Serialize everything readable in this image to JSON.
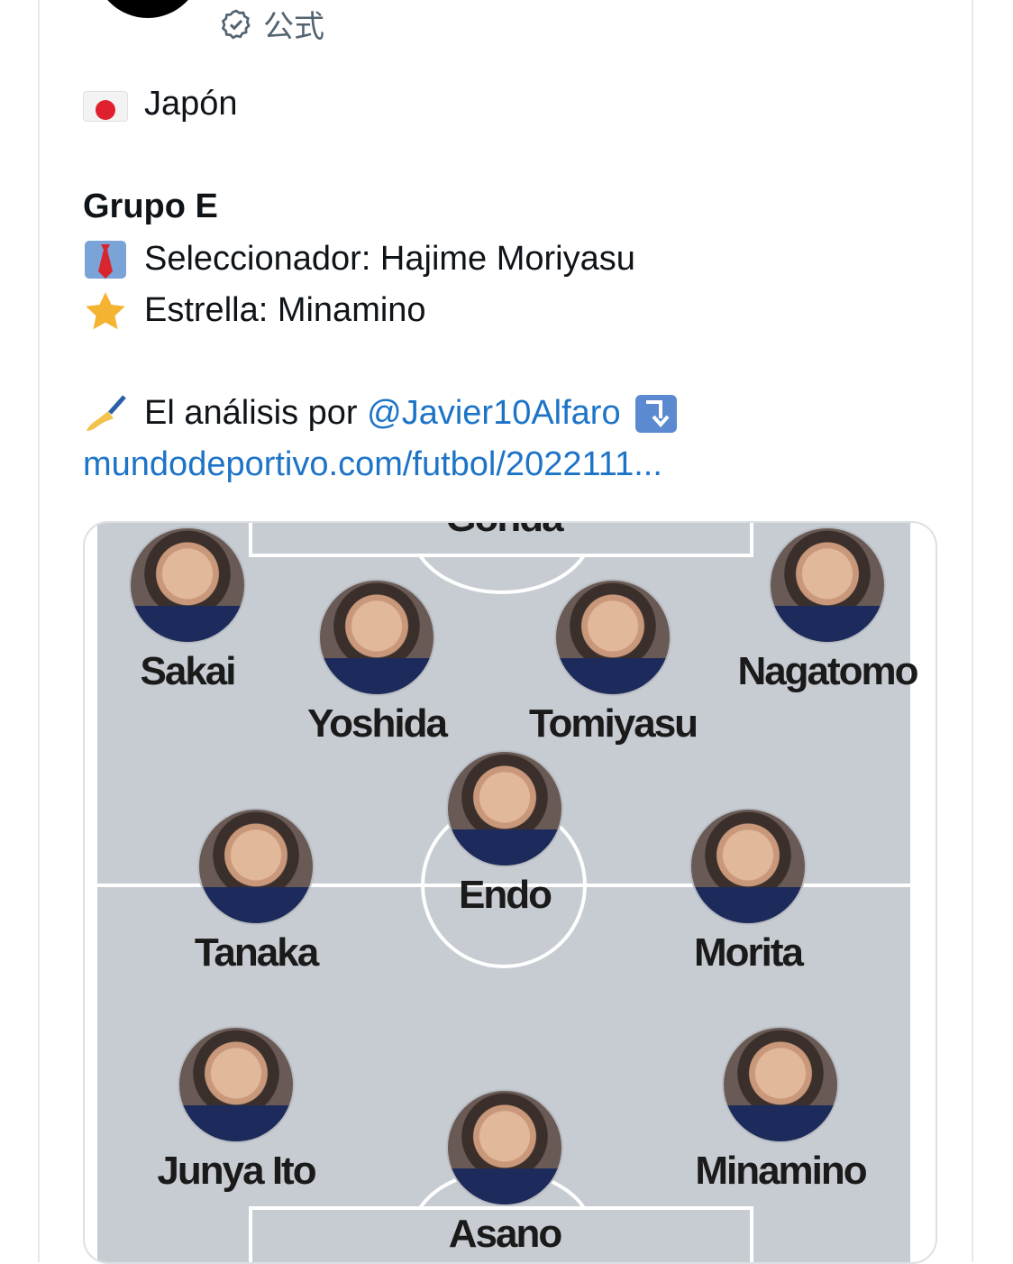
{
  "header": {
    "verified_label": "公式"
  },
  "tweet": {
    "country": "Japón",
    "group": "Grupo E",
    "coach": "Seleccionador: Hajime Moriyasu",
    "star": "Estrella: Minamino",
    "analysis_prefix": "El análisis por",
    "mention": "@Javier10Alfaro",
    "link": "mundodeportivo.com/futbol/2022111..."
  },
  "lineup": {
    "goalkeeper_partial": "Gonda",
    "players": [
      {
        "name": "Sakai"
      },
      {
        "name": "Yoshida"
      },
      {
        "name": "Tomiyasu"
      },
      {
        "name": "Nagatomo"
      },
      {
        "name": "Endo"
      },
      {
        "name": "Tanaka"
      },
      {
        "name": "Morita"
      },
      {
        "name": "Junya Ito"
      },
      {
        "name": "Asano"
      },
      {
        "name": "Minamino"
      }
    ]
  },
  "colors": {
    "link": "#1d74c7",
    "pitch": "#c7ccd2",
    "flag_red": "#e0202e"
  }
}
